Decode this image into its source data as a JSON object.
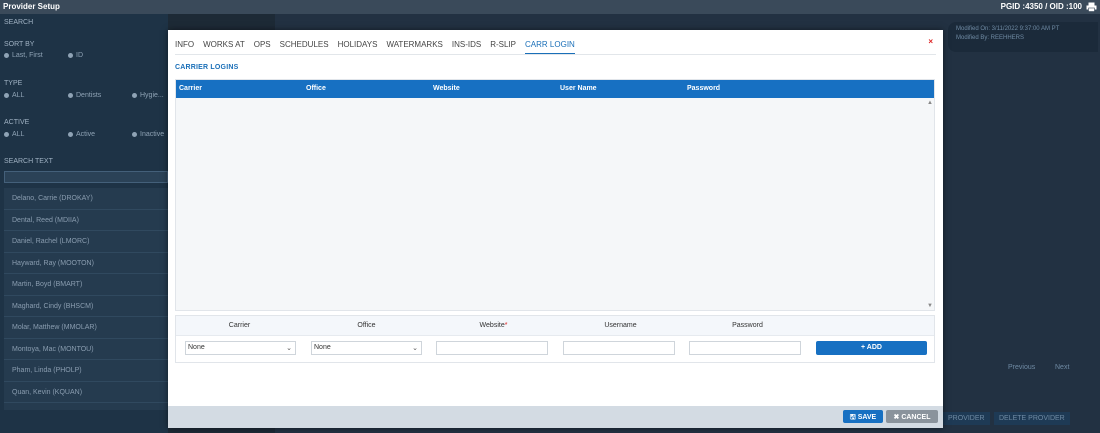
{
  "app": {
    "title": "Provider Setup",
    "ids": "PGID :4350  /  OID :100",
    "printer_icon": "printer-icon"
  },
  "sidebar": {
    "search_label": "SEARCH",
    "sort_label": "SORT BY",
    "sort_options": [
      "Last, First",
      "ID"
    ],
    "type_label": "TYPE",
    "type_options": [
      "ALL",
      "Dentists",
      "Hygie..."
    ],
    "active_label": "ACTIVE",
    "active_options": [
      "ALL",
      "Active",
      "Inactive"
    ],
    "search_text_label": "SEARCH TEXT",
    "providers": [
      "Delano, Carrie (DROKAY)",
      "Dental, Reed (MDIIA)",
      "Daniel, Rachel (LMORC)",
      "Hayward, Ray (MOOTON)",
      "Martin, Boyd (BMART)",
      "Maghard, Cindy (BHSCM)",
      "Molar, Matthew (MMOLAR)",
      "Montoya, Mac (MONTOU)",
      "Pham, Linda (PHOLP)",
      "Quan, Kevin (KQUAN)"
    ]
  },
  "background": {
    "modified_on": "Modified On: 3/11/2022 9:37:00 AM PT",
    "modified_by": "Modified By: REEHHERS",
    "pager_prev": "Previous",
    "pager_next": "Next",
    "bg_btn_provider": "PROVIDER",
    "bg_btn_delete": "DELETE PROVIDER"
  },
  "modal": {
    "close_label": "×",
    "tabs": [
      "INFO",
      "WORKS AT",
      "OPS",
      "SCHEDULES",
      "HOLIDAYS",
      "WATERMARKS",
      "INS-IDS",
      "R-SLIP",
      "CARR LOGIN"
    ],
    "active_tab": "CARR LOGIN",
    "section_title": "CARRIER LOGINS",
    "grid_columns": [
      "Carrier",
      "Office",
      "Website",
      "User Name",
      "Password"
    ],
    "grid_rows": [],
    "add_form": {
      "headers": [
        "Carrier",
        "Office",
        "Website",
        "Username",
        "Password"
      ],
      "website_required_mark": "*",
      "carrier_value": "None",
      "office_value": "None",
      "add_label": "+ ADD"
    },
    "save_label": "SAVE",
    "cancel_label": "CANCEL"
  },
  "colors": {
    "accent": "#1770c2",
    "required": "#dd2222",
    "overlay": "#1d2a36"
  }
}
